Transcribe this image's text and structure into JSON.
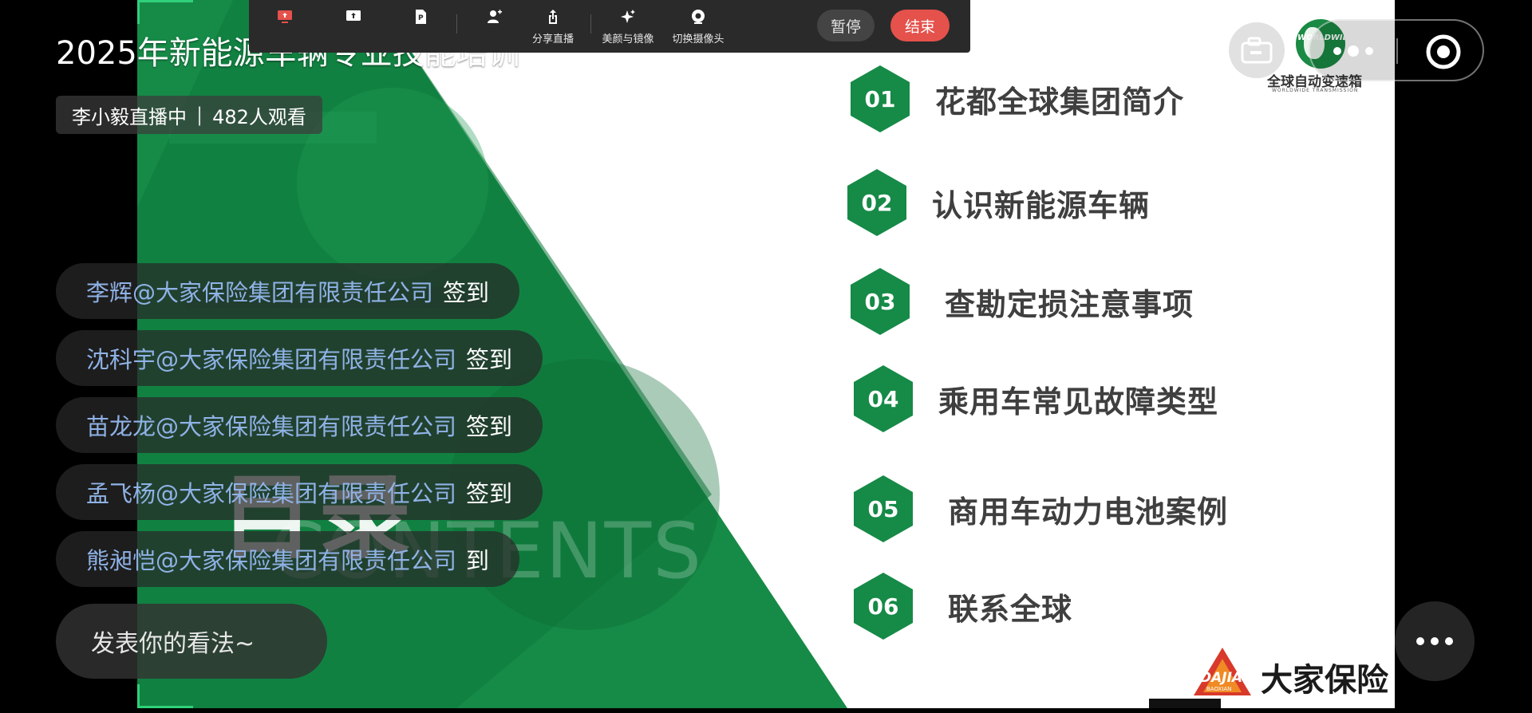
{
  "live": {
    "title": "2025年新能源车辆专业技能培训",
    "host_status": "李小毅直播中",
    "separator": "|",
    "viewer_count": "482人观看"
  },
  "comments": [
    {
      "user": "李辉@大家保险集团有限责任公司",
      "action": "签到"
    },
    {
      "user": "沈科宇@大家保险集团有限责任公司",
      "action": "签到"
    },
    {
      "user": "苗龙龙@大家保险集团有限责任公司",
      "action": "签到"
    },
    {
      "user": "孟飞杨@大家保险集团有限责任公司",
      "action": "签到"
    },
    {
      "user": "熊昶恺@大家保险集团有限责任公司",
      "action": "到"
    }
  ],
  "comment_input": {
    "placeholder": "发表你的看法~"
  },
  "toolbar": {
    "tools": [
      {
        "label": "",
        "icon": "screen-share-icon"
      },
      {
        "label": "",
        "icon": "upload-icon"
      },
      {
        "label": "",
        "icon": "document-icon"
      },
      {
        "label": "",
        "icon": "user-add-icon"
      },
      {
        "label": "分享直播",
        "icon": "share-icon"
      },
      {
        "label": "美颜与镜像",
        "icon": "sparkle-icon"
      },
      {
        "label": "切换摄像头",
        "icon": "camera-icon"
      }
    ],
    "pause_label": "暂停",
    "end_label": "结束"
  },
  "slide": {
    "heading": "目录",
    "subheading": "CONTENTS",
    "items": [
      {
        "num": "01",
        "label": "花都全球集团简介"
      },
      {
        "num": "02",
        "label": "认识新能源车辆"
      },
      {
        "num": "03",
        "label": "查勘定损注意事项"
      },
      {
        "num": "04",
        "label": "乘用车常见故障类型"
      },
      {
        "num": "05",
        "label": "商用车动力电池案例"
      },
      {
        "num": "06",
        "label": "联系全球"
      }
    ],
    "logo_worldwide": {
      "globe_text": "WORLDWIDE",
      "cn": "全球自动变速箱",
      "en": "WORLDWIDE TRANSMISSION"
    },
    "logo_dajia": {
      "mark_text": "DAJIA",
      "mark_sub": "BAOXIAN",
      "name": "大家保险"
    }
  },
  "colors": {
    "slide_green": "#168a47",
    "end_red": "#e5514b",
    "comment_user_blue": "#8fb2e6"
  }
}
